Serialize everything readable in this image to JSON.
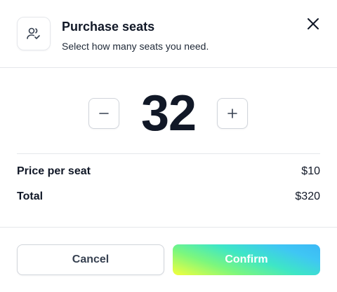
{
  "header": {
    "title": "Purchase seats",
    "subtitle": "Select how many seats you need.",
    "icon": "users-check-icon"
  },
  "stepper": {
    "value": "32",
    "decrement_symbol": "−",
    "increment_symbol": "+"
  },
  "summary": {
    "rows": [
      {
        "label": "Price per seat",
        "value": "$10"
      },
      {
        "label": "Total",
        "value": "$320"
      }
    ]
  },
  "footer": {
    "cancel_label": "Cancel",
    "confirm_label": "Confirm"
  },
  "colors": {
    "text": "#111827",
    "border": "#e5e7eb",
    "confirm_gradient": [
      "#f5ff3a",
      "#7cf77d",
      "#3ee6c6",
      "#3fc6f4"
    ]
  }
}
